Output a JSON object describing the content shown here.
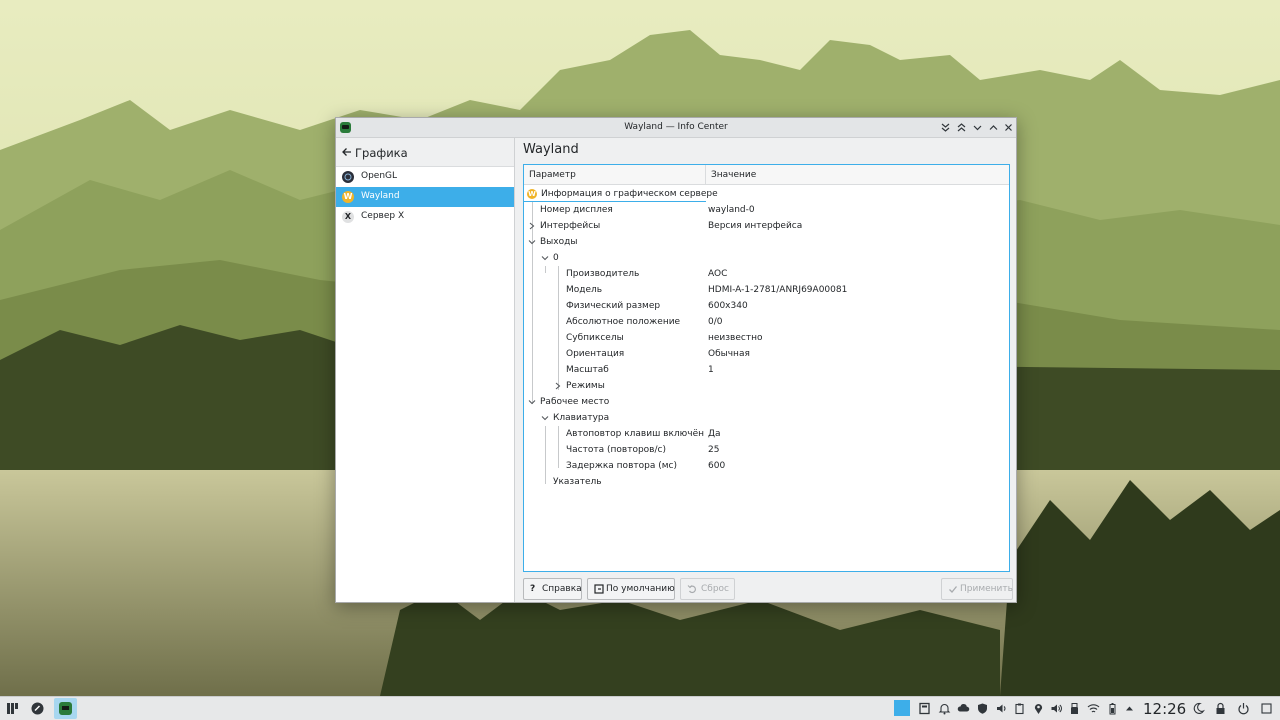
{
  "window": {
    "title": "Wayland — Info Center",
    "buttons": {
      "keep_below": "⌄⌄",
      "keep_above": "⌃⌃",
      "minimize": "⌄",
      "maximize": "⌃",
      "close": "✕"
    }
  },
  "sidebar": {
    "back_label": "Графика",
    "items": [
      {
        "label": "OpenGL",
        "icon": "opengl-icon",
        "selected": false
      },
      {
        "label": "Wayland",
        "icon": "wayland-icon",
        "selected": true
      },
      {
        "label": "Сервер X",
        "icon": "x-server-icon",
        "selected": false
      }
    ]
  },
  "main": {
    "title": "Wayland",
    "columns": {
      "param": "Параметр",
      "value": "Значение"
    },
    "rows": [
      {
        "key": "Информация о графическом сервере",
        "value": ""
      },
      {
        "key": "Номер дисплея",
        "value": "wayland-0"
      },
      {
        "key": "Интерфейсы",
        "value": "Версия интерфейса"
      },
      {
        "key": "Выходы",
        "value": ""
      },
      {
        "key": "0",
        "value": ""
      },
      {
        "key": "Производитель",
        "value": "AOC"
      },
      {
        "key": "Модель",
        "value": "HDMI-A-1-2781/ANRJ69A00081"
      },
      {
        "key": "Физический размер",
        "value": "600x340"
      },
      {
        "key": "Абсолютное положение",
        "value": "0/0"
      },
      {
        "key": "Субпикселы",
        "value": "неизвестно"
      },
      {
        "key": "Ориентация",
        "value": "Обычная"
      },
      {
        "key": "Масштаб",
        "value": "1"
      },
      {
        "key": "Режимы",
        "value": ""
      },
      {
        "key": "Рабочее место",
        "value": ""
      },
      {
        "key": "Клавиатура",
        "value": ""
      },
      {
        "key": "Автоповтор клавиш включён",
        "value": "Да"
      },
      {
        "key": "Частота (повторов/с)",
        "value": "25"
      },
      {
        "key": "Задержка повтора (мс)",
        "value": "600"
      },
      {
        "key": "Указатель",
        "value": ""
      }
    ]
  },
  "buttons": {
    "help": "Справка",
    "defaults": "По умолчанию",
    "reset": "Сброс",
    "apply": "Применить"
  },
  "taskbar": {
    "clock": "12:26"
  },
  "colors": {
    "accent": "#3daee9",
    "window_bg": "#eff0f1",
    "panel_bg": "#e7e8e9"
  }
}
